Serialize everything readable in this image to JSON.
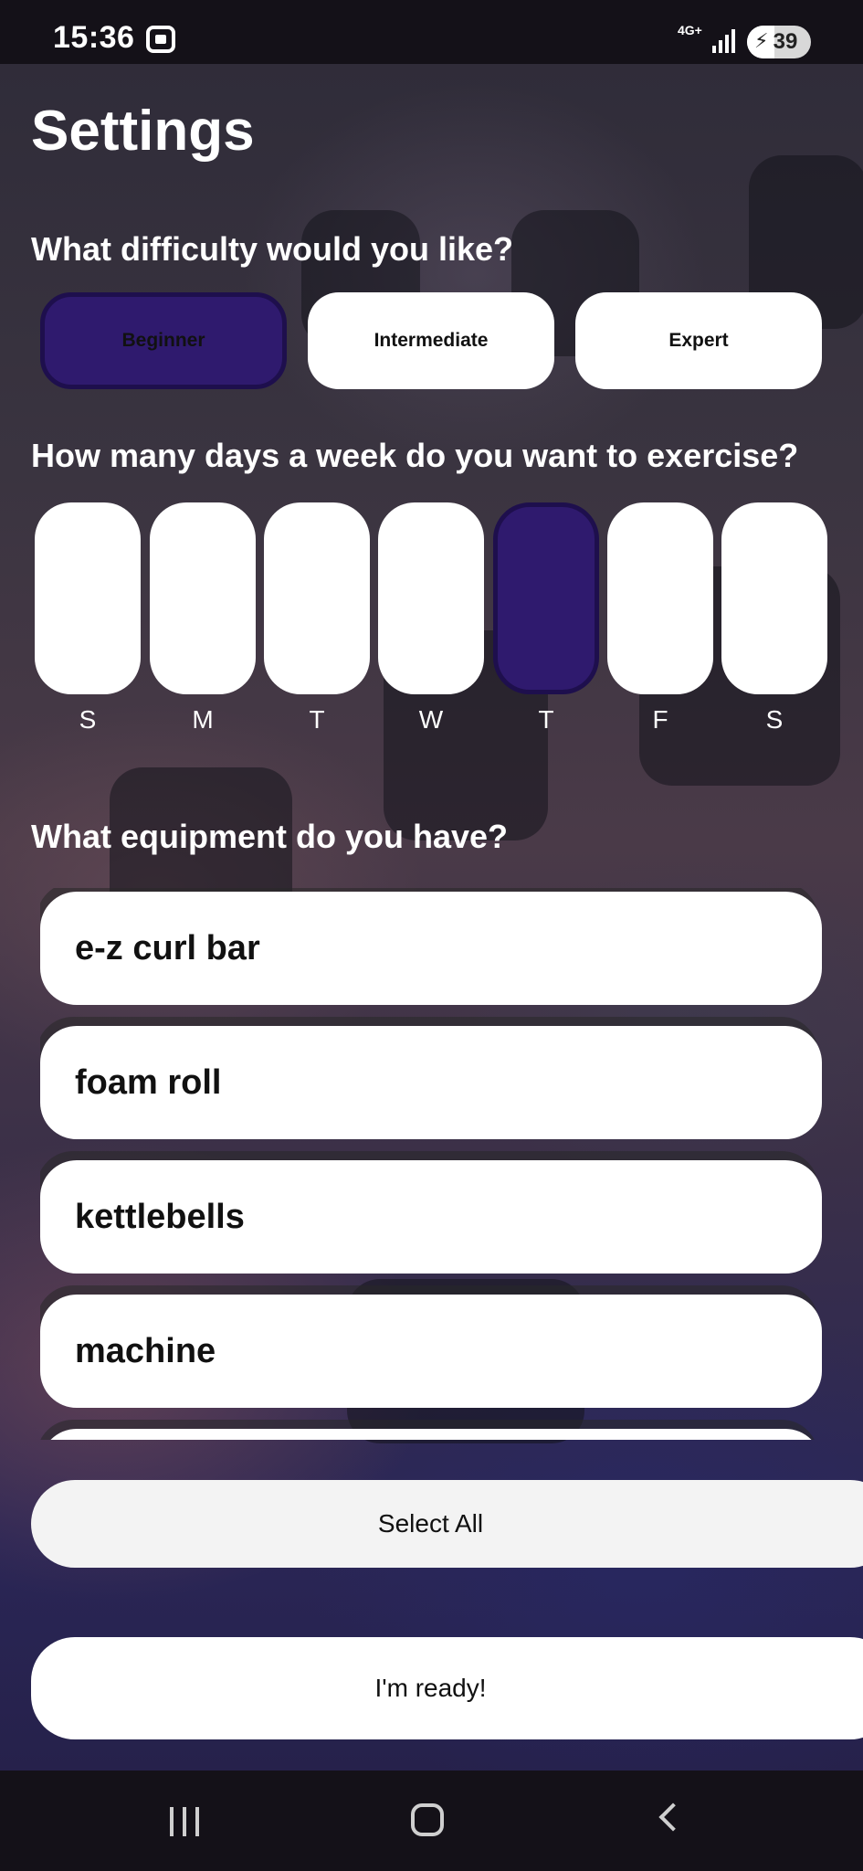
{
  "status_bar": {
    "time": "15:36",
    "network": "4G+",
    "battery": "39",
    "icons": [
      "screenshot-icon",
      "signal-icon",
      "battery-charging-icon"
    ]
  },
  "page": {
    "title": "Settings"
  },
  "difficulty": {
    "question": "What difficulty would you like?",
    "options": [
      "Beginner",
      "Intermediate",
      "Expert"
    ],
    "selected": "Beginner"
  },
  "days": {
    "question": "How many days a week do you want to exercise?",
    "labels": [
      "S",
      "M",
      "T",
      "W",
      "T",
      "F",
      "S"
    ],
    "selected_index": 4
  },
  "equipment": {
    "question": "What equipment do you have?",
    "items": [
      "e-z curl bar",
      "foam roll",
      "kettlebells",
      "machine"
    ]
  },
  "buttons": {
    "select_all": "Select All",
    "ready": "I'm ready!"
  },
  "colors": {
    "accent": "#2f1a6e",
    "button_bg": "#ffffff"
  },
  "nav": {
    "icons": [
      "recent-apps-icon",
      "home-icon",
      "back-icon"
    ]
  }
}
